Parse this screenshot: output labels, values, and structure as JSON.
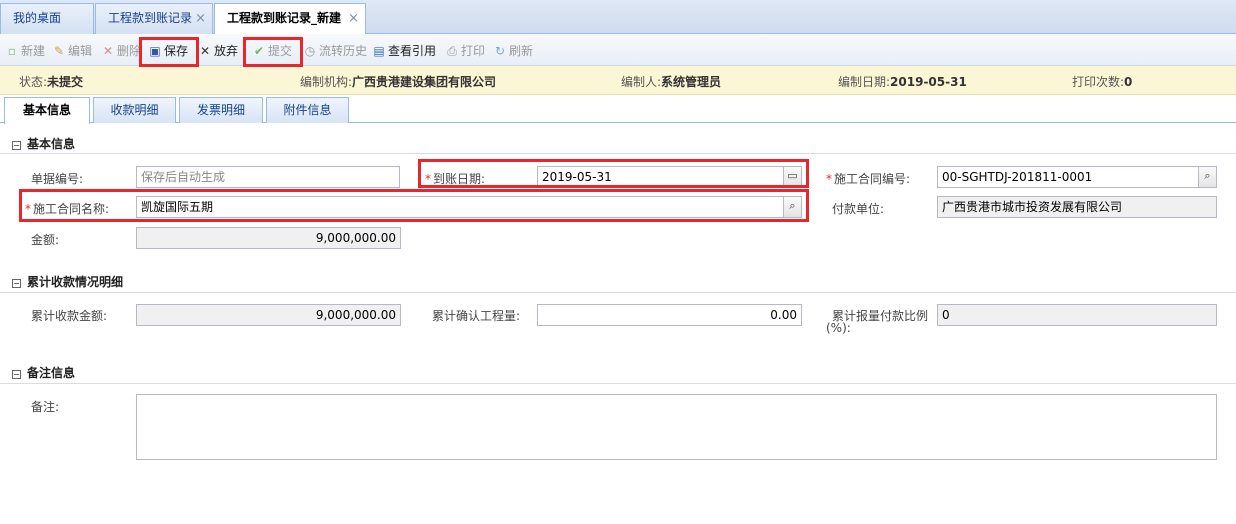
{
  "tabs": [
    {
      "label": "我的桌面"
    },
    {
      "label": "工程款到账记录",
      "close": "×"
    },
    {
      "label": "工程款到账记录_新建",
      "close": "×"
    }
  ],
  "toolbar": {
    "new": "新建",
    "edit": "编辑",
    "delete": "删除",
    "save": "保存",
    "discard": "放弃",
    "submit": "提交",
    "history": "流转历史",
    "references": "查看引用",
    "print": "打印",
    "refresh": "刷新"
  },
  "status": {
    "state_label": "状态:",
    "state_value": "未提交",
    "org_label": "编制机构:",
    "org_value": "广西贵港建设集团有限公司",
    "author_label": "编制人:",
    "author_value": "系统管理员",
    "date_label": "编制日期:",
    "date_value": "2019-05-31",
    "print_label": "打印次数:",
    "print_value": "0"
  },
  "subtabs": [
    "基本信息",
    "收款明细",
    "发票明细",
    "附件信息"
  ],
  "basic": {
    "title": "基本信息",
    "toggle": "⊟",
    "doc_no_label": "单据编号:",
    "doc_no_placeholder": "保存后自动生成",
    "arrive_date_label": "到账日期:",
    "arrive_date_value": "2019-05-31",
    "contract_no_label": "施工合同编号:",
    "contract_no_value": "00-SGHTDJ-201811-0001",
    "contract_name_label": "施工合同名称:",
    "contract_name_value": "凯旋国际五期",
    "payer_label": "付款单位:",
    "payer_value": "广西贵港市城市投资发展有限公司",
    "amount_label": "金额:",
    "amount_value": "9,000,000.00",
    "required_mark": "*"
  },
  "cumulative": {
    "title": "累计收款情况明细",
    "toggle": "⊟",
    "received_label": "累计收款金额:",
    "received_value": "9,000,000.00",
    "confirmed_label": "累计确认工程量:",
    "confirmed_value": "0.00",
    "ratio_label_1": "累计报量付款比例",
    "ratio_label_2": "(%):",
    "ratio_value": "0"
  },
  "remarks": {
    "title": "备注信息",
    "toggle": "⊟",
    "label": "备注:",
    "value": ""
  },
  "colors": {
    "highlight": "#e8262b",
    "tab_border": "#99bbe8",
    "status_bg": "#fbf7d6"
  }
}
